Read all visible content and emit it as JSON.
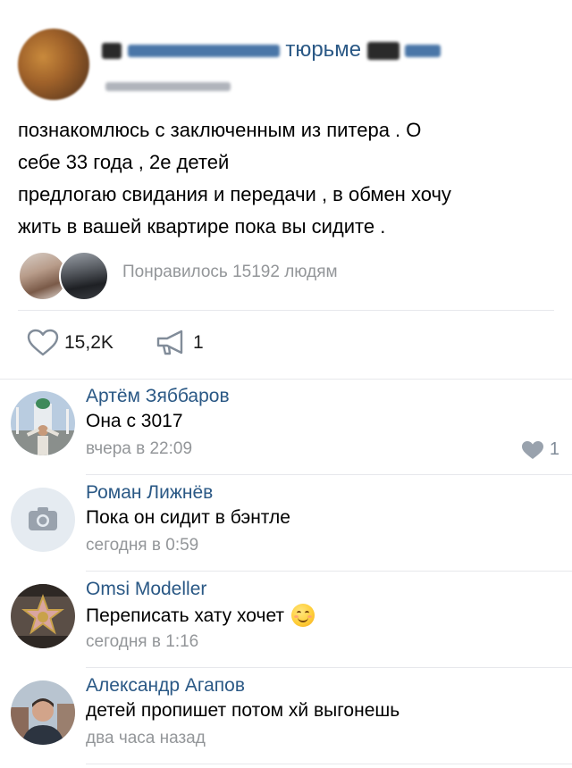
{
  "post": {
    "group_name_visible": "тюрьме",
    "text_lines": [
      "познакомлюсь с заключенным из питера . О",
      "себе 33 года , 2е детей",
      "предлогаю свидания и передачи , в обмен хочу",
      "жить в вашей квартире пока вы сидите ."
    ],
    "liked_text": "Понравилось 15192 людям",
    "likes_count": "15,2K",
    "shares_count": "1"
  },
  "comments": [
    {
      "author": "Артём Зяббаров",
      "text": "Она с 3017",
      "time": "вчера в 22:09",
      "likes": "1"
    },
    {
      "author": "Роман Лижнёв",
      "text": "Пока он сидит в бэнтле",
      "time": "сегодня в 0:59"
    },
    {
      "author": "Omsi Modeller",
      "text": "Переписать хату хочет",
      "time": "сегодня в 1:16"
    },
    {
      "author": "Александр Агапов",
      "text": "детей пропишет потом хй выгонешь",
      "time": "два часа назад"
    }
  ],
  "colors": {
    "link": "#2a5885",
    "secondary": "#939699",
    "divider": "#e7e8ec"
  }
}
